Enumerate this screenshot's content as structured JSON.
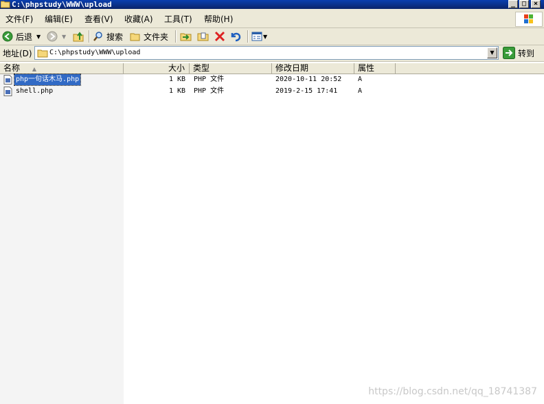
{
  "window": {
    "title": "C:\\phpstudy\\WWW\\upload",
    "controls": {
      "minimize": "_",
      "maximize": "□",
      "close": "×"
    }
  },
  "menu": {
    "items": [
      {
        "label": "文件(F)"
      },
      {
        "label": "编辑(E)"
      },
      {
        "label": "查看(V)"
      },
      {
        "label": "收藏(A)"
      },
      {
        "label": "工具(T)"
      },
      {
        "label": "帮助(H)"
      }
    ]
  },
  "toolbar": {
    "back_label": "后退",
    "search_label": "搜索",
    "folders_label": "文件夹"
  },
  "address": {
    "label": "地址(D)",
    "value": "C:\\phpstudy\\WWW\\upload",
    "go_label": "转到"
  },
  "list": {
    "columns": {
      "name": "名称",
      "size": "大小",
      "type": "类型",
      "modified": "修改日期",
      "attributes": "属性"
    },
    "files": [
      {
        "name": "php一句话木马.php",
        "size": "1 KB",
        "type": "PHP 文件",
        "modified": "2020-10-11 20:52",
        "attributes": "A",
        "selected": true
      },
      {
        "name": "shell.php",
        "size": "1 KB",
        "type": "PHP 文件",
        "modified": "2019-2-15 17:41",
        "attributes": "A",
        "selected": false
      }
    ]
  },
  "watermark": "https://blog.csdn.net/qq_18741387",
  "colors": {
    "titlebar": "#0a246a",
    "selection": "#316ac5",
    "chrome": "#ece9d8"
  }
}
